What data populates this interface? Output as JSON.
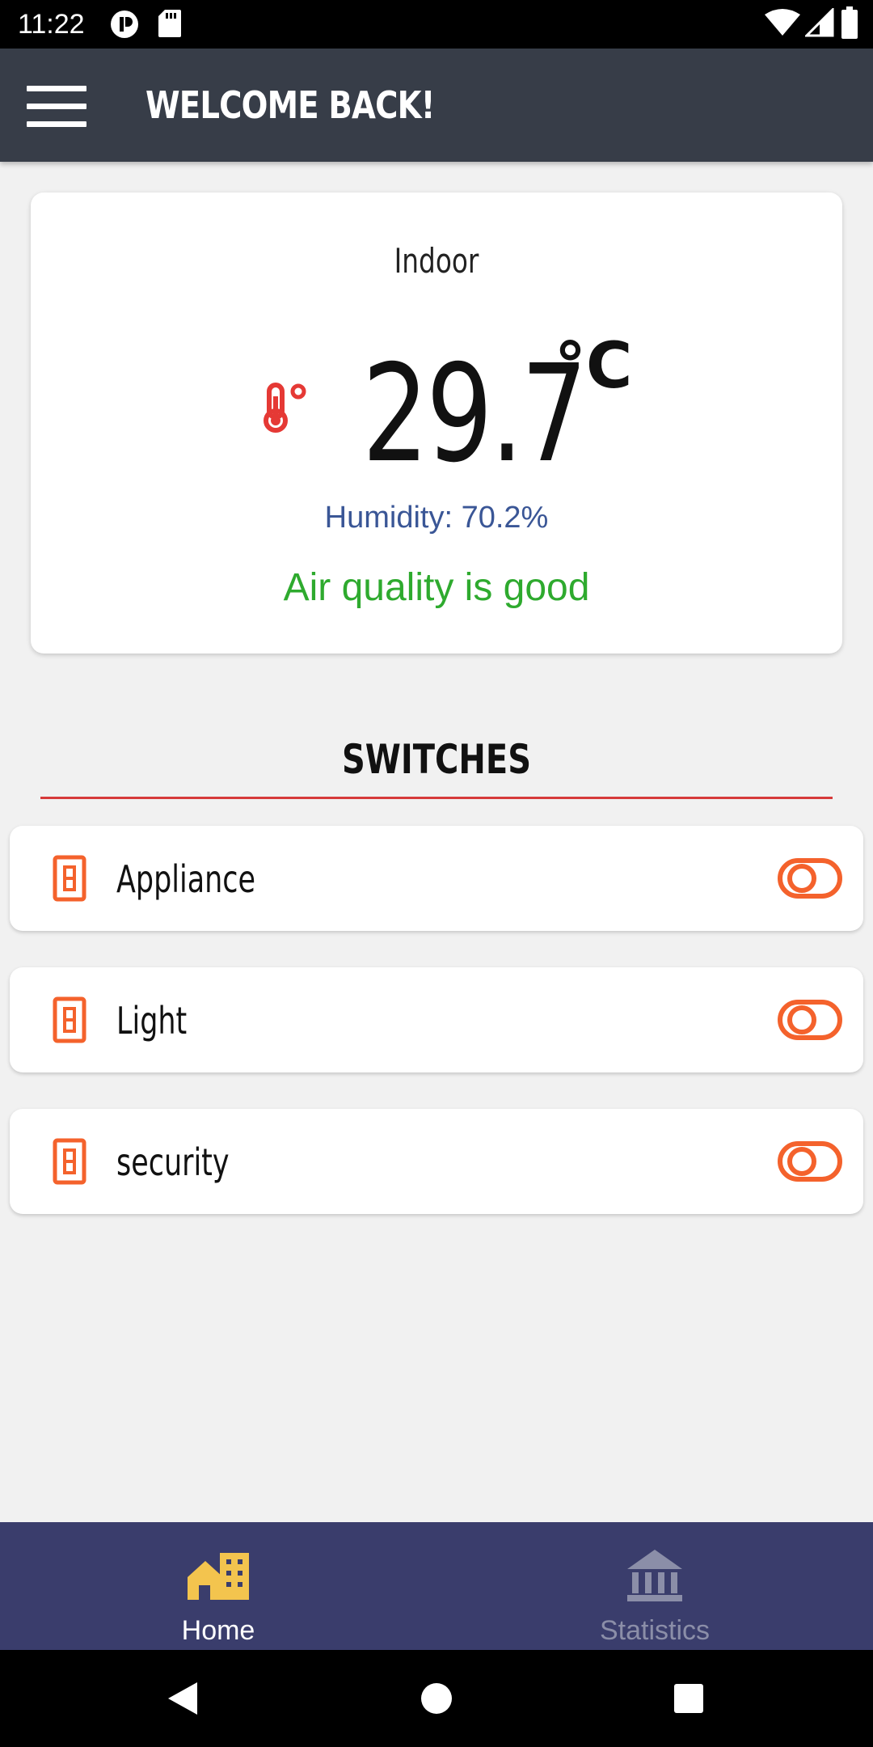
{
  "status_bar": {
    "time": "11:22"
  },
  "app_bar": {
    "title": "WELCOME BACK!",
    "menu_icon": "hamburger-menu-icon"
  },
  "indoor": {
    "label": "Indoor",
    "temperature": "29.7",
    "unit": "°C",
    "humidity": "Humidity: 70.2%",
    "air_quality": "Air quality is good",
    "colors": {
      "thermometer": "#e53935",
      "humidity": "#3a5696",
      "air_quality": "#2eaa2e"
    }
  },
  "switches": {
    "title": "SWITCHES",
    "accent_color": "#f4622c",
    "items": [
      {
        "label": "Appliance",
        "icon": "wall-switch-icon",
        "toggle_state": "off"
      },
      {
        "label": "Light",
        "icon": "wall-switch-icon",
        "toggle_state": "off"
      },
      {
        "label": "security",
        "icon": "wall-switch-icon",
        "toggle_state": "off"
      }
    ]
  },
  "bottom_nav": {
    "items": [
      {
        "label": "Home",
        "icon": "home-building-icon",
        "active": true,
        "color": "#f3c44e"
      },
      {
        "label": "Statistics",
        "icon": "bank-statistics-icon",
        "active": false,
        "color": "#8b8ea8"
      }
    ]
  }
}
